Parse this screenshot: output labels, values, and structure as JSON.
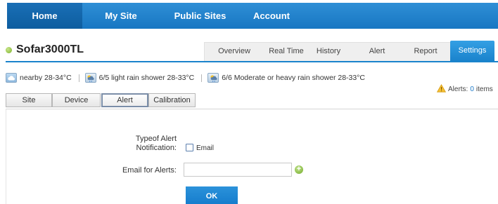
{
  "nav": {
    "items": [
      {
        "label": "Home",
        "active": true
      },
      {
        "label": "My Site",
        "active": false
      },
      {
        "label": "Public Sites",
        "active": false
      },
      {
        "label": "Account",
        "active": false
      }
    ]
  },
  "site": {
    "title": "Sofar3000TL",
    "status_color": "#7cb329"
  },
  "tabs": [
    {
      "label": "Overview"
    },
    {
      "label": "Real Time"
    },
    {
      "label": "History"
    },
    {
      "label": "Alert"
    },
    {
      "label": "Report"
    },
    {
      "label": "Settings",
      "active": true
    }
  ],
  "weather": {
    "items": [
      {
        "icon": "cloud-icon",
        "text": "nearby 28-34°C"
      },
      {
        "icon": "rain-shower-icon",
        "text": "6/5 light rain shower 28-33°C"
      },
      {
        "icon": "rain-shower-icon",
        "text": "6/6 Moderate or heavy rain shower 28-33°C"
      }
    ]
  },
  "alerts": {
    "icon": "warning-icon",
    "prefix": "Alerts:",
    "count": "0",
    "suffix": "items"
  },
  "subtabs": [
    {
      "label": "Site"
    },
    {
      "label": "Device"
    },
    {
      "label": "Alert",
      "active": true
    },
    {
      "label": "Calibration"
    }
  ],
  "form": {
    "alert_type_label_line1": "Typeof Alert",
    "alert_type_label_line2": "Notification:",
    "email_checkbox_label": "Email",
    "email_field_label": "Email for Alerts:",
    "email_value": "",
    "ok_label": "OK"
  },
  "colors": {
    "nav_blue": "#1776c2",
    "accent": "#1a83cc"
  }
}
